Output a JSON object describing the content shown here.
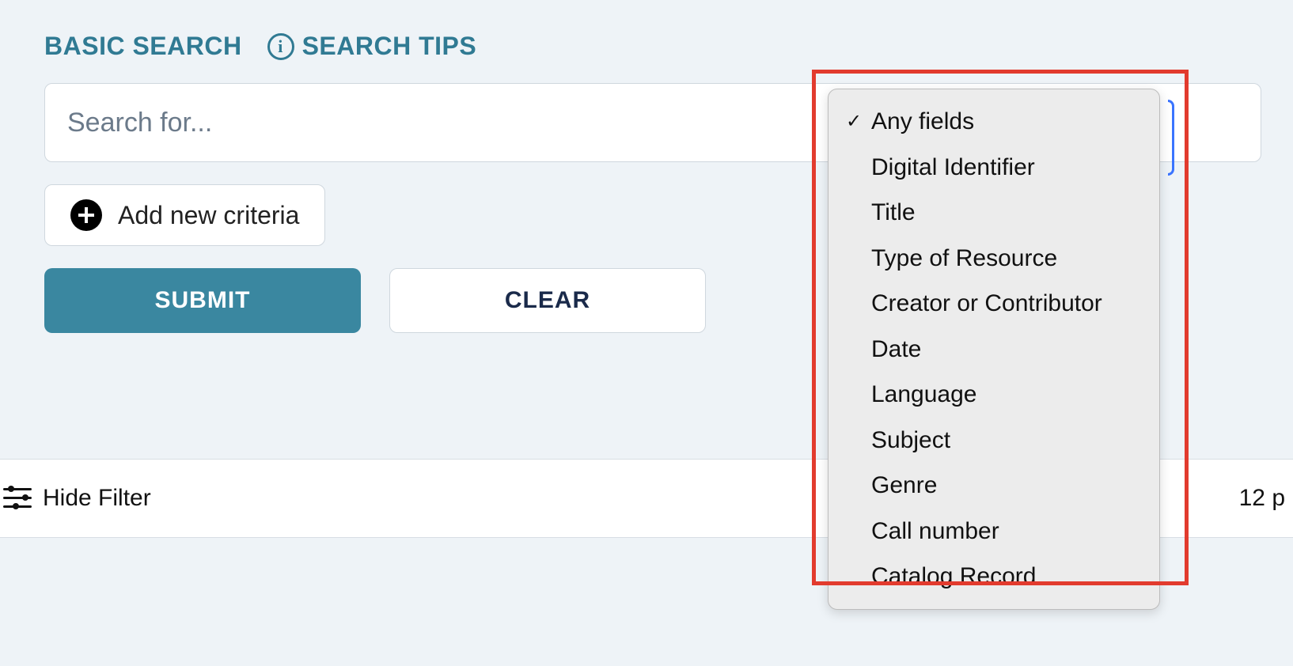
{
  "tabs": {
    "basic_search": "BASIC SEARCH",
    "search_tips": "SEARCH TIPS"
  },
  "search": {
    "placeholder": "Search for...",
    "value": ""
  },
  "add_criteria_label": "Add new criteria",
  "buttons": {
    "submit": "SUBMIT",
    "clear": "CLEAR"
  },
  "filter_bar": {
    "hide_filter": "Hide Filter",
    "right_text": "12 p"
  },
  "field_dropdown": {
    "selected_index": 0,
    "options": [
      "Any fields",
      "Digital Identifier",
      "Title",
      "Type of Resource",
      "Creator or Contributor",
      "Date",
      "Language",
      "Subject",
      "Genre",
      "Call number",
      "Catalog Record"
    ]
  }
}
